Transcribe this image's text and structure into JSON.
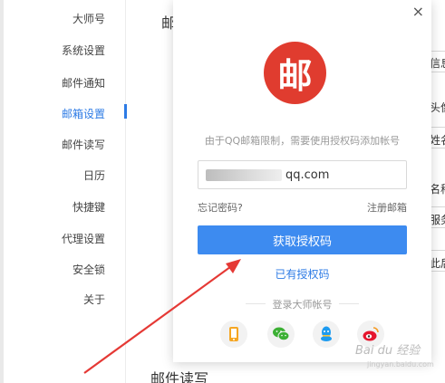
{
  "sidebar": {
    "items": [
      {
        "label": "大师号",
        "active": false
      },
      {
        "label": "系统设置",
        "active": false
      },
      {
        "label": "邮件通知",
        "active": false
      },
      {
        "label": "邮箱设置",
        "active": true
      },
      {
        "label": "邮件读写",
        "active": false
      },
      {
        "label": "日历",
        "active": false
      },
      {
        "label": "快捷键",
        "active": false
      },
      {
        "label": "代理设置",
        "active": false
      },
      {
        "label": "安全锁",
        "active": false
      },
      {
        "label": "关于",
        "active": false
      }
    ]
  },
  "background": {
    "top_heading_partial": "邮",
    "bottom_heading": "邮件读写",
    "right_fragments": [
      "信息",
      "头像",
      "姓名",
      "名称",
      "服务",
      "此后"
    ]
  },
  "modal": {
    "close_glyph": "×",
    "logo_char": "邮",
    "hint": "由于QQ邮箱限制，需要使用授权码添加帐号",
    "account_suffix": "qq.com",
    "forgot_password": "忘记密码?",
    "register": "注册邮箱",
    "get_code_button": "获取授权码",
    "have_code_link": "已有授权码",
    "login_master_label": "登录大师帐号",
    "social_icons": [
      "phone-icon",
      "wechat-icon",
      "qq-icon",
      "weibo-icon"
    ]
  },
  "watermark": {
    "text": "Bai du 经验",
    "sub": "jingyan.baidu.com"
  },
  "colors": {
    "accent": "#2d7be5",
    "button": "#3d8bf0",
    "logo": "#e03c2f",
    "arrow": "#e53935"
  }
}
